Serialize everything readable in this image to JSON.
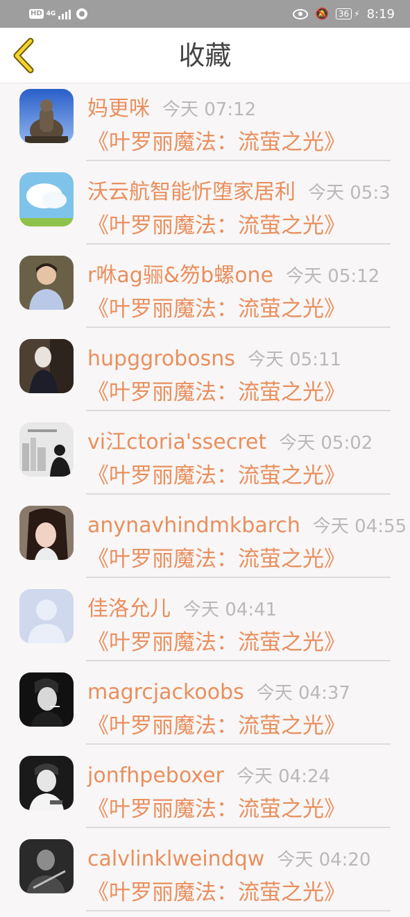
{
  "status_bar": {
    "hd": "HD",
    "network": "4G",
    "battery": "36",
    "time": "8:19"
  },
  "header": {
    "title": "收藏"
  },
  "items": [
    {
      "name": "妈更咪",
      "time": "今天 07:12",
      "title": "《叶罗丽魔法：流萤之光》",
      "avatar": "buddha-statue-avatar"
    },
    {
      "name": "沃云航智能忻堕家居利",
      "time": "今天 05:3",
      "title": "《叶罗丽魔法：流萤之光》",
      "avatar": "sky-cloud-avatar"
    },
    {
      "name": "r咻ag骊&笏b螺one",
      "time": "今天 05:12",
      "title": "《叶罗丽魔法：流萤之光》",
      "avatar": "boy-portrait-avatar"
    },
    {
      "name": "hupggrobosns",
      "time": "今天 05:11",
      "title": "《叶罗丽魔法：流萤之光》",
      "avatar": "girl-dark-avatar"
    },
    {
      "name": "vi江ctoria'ssecret",
      "time": "今天 05:02",
      "title": "《叶罗丽魔法：流萤之光》",
      "avatar": "city-silhouette-avatar"
    },
    {
      "name": "anynavhindmkbarch",
      "time": "今天 04:55",
      "title": "《叶罗丽魔法：流萤之光》",
      "avatar": "girl-selfie-avatar"
    },
    {
      "name": "佳洛允儿",
      "time": "今天 04:41",
      "title": "《叶罗丽魔法：流萤之光》",
      "avatar": "default-user-avatar"
    },
    {
      "name": "magrcjackoobs",
      "time": "今天 04:37",
      "title": "《叶罗丽魔法：流萤之光》",
      "avatar": "smoking-man-avatar"
    },
    {
      "name": "jonfhpeboxer",
      "time": "今天 04:24",
      "title": "《叶罗丽魔法：流萤之光》",
      "avatar": "bw-man-avatar"
    },
    {
      "name": "calvlinklweindqw",
      "time": "今天 04:20",
      "title": "《叶罗丽魔法：流萤之光》",
      "avatar": "bw-guitar-avatar"
    }
  ]
}
